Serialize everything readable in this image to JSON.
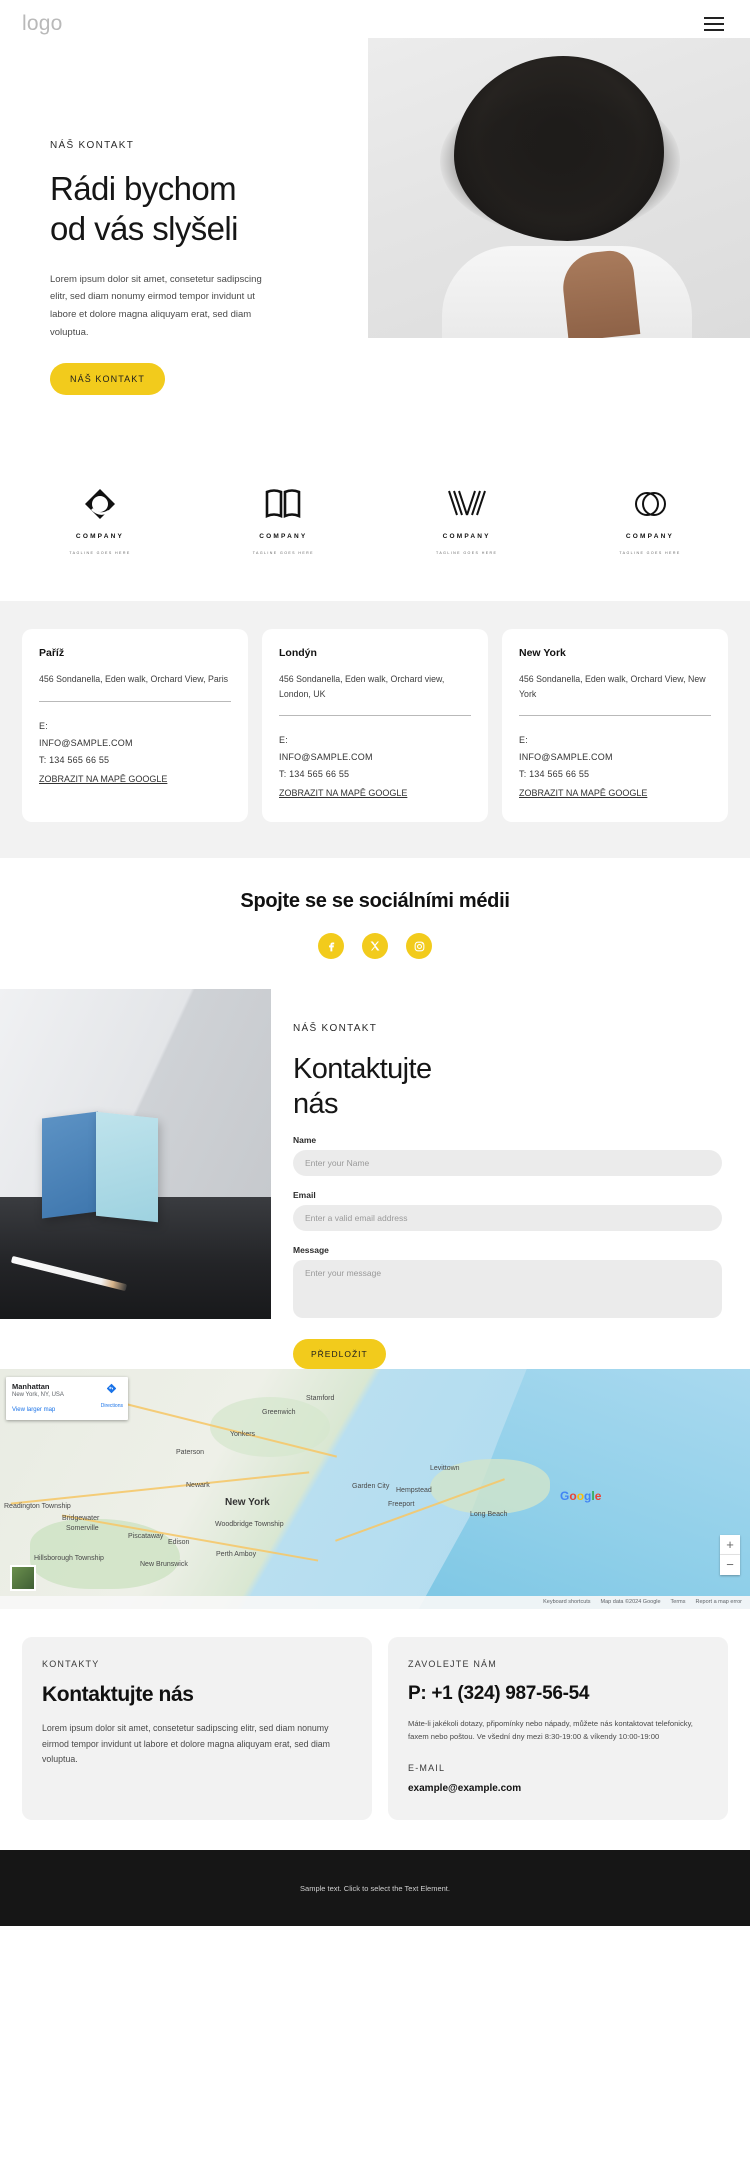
{
  "header": {
    "logo": "logo",
    "menu_icon": "hamburger-menu-icon"
  },
  "hero": {
    "eyebrow": "NÁŠ KONTAKT",
    "title_line1": "Rádi bychom",
    "title_line2": "od vás slyšeli",
    "paragraph": "Lorem ipsum dolor sit amet, consetetur sadipscing elitr, sed diam nonumy eirmod tempor invidunt ut labore et dolore magna aliquyam erat, sed diam voluptua.",
    "cta": "NÁŠ KONTAKT"
  },
  "logos": [
    {
      "name": "COMPANY",
      "tagline": "TAGLINE GOES HERE",
      "mark": "ring-logo-icon"
    },
    {
      "name": "COMPANY",
      "tagline": "TAGLINE GOES HERE",
      "mark": "book-logo-icon"
    },
    {
      "name": "COMPANY",
      "tagline": "TAGLINE GOES HERE",
      "mark": "chevron-logo-icon"
    },
    {
      "name": "COMPANY",
      "tagline": "TAGLINE GOES HERE",
      "mark": "circles-logo-icon"
    }
  ],
  "locations": [
    {
      "city": "Paříž",
      "address": "456 Sondanella, Eden walk, Orchard View, Paris",
      "email_label": "E:",
      "email": "INFO@SAMPLE.COM",
      "phone": "T: 134 565 66 55",
      "map_link": "ZOBRAZIT NA MAPĚ GOOGLE"
    },
    {
      "city": "Londýn",
      "address": "456 Sondanella, Eden walk, Orchard view, London, UK",
      "email_label": "E:",
      "email": "INFO@SAMPLE.COM",
      "phone": "T: 134 565 66 55",
      "map_link": "ZOBRAZIT NA MAPĚ GOOGLE"
    },
    {
      "city": "New York",
      "address": "456 Sondanella, Eden walk, Orchard View, New York",
      "email_label": "E:",
      "email": "INFO@SAMPLE.COM",
      "phone": "T: 134 565 66 55",
      "map_link": "ZOBRAZIT NA MAPĚ GOOGLE"
    }
  ],
  "social": {
    "heading": "Spojte se se sociálními médii",
    "items": [
      {
        "name": "facebook-icon"
      },
      {
        "name": "x-twitter-icon"
      },
      {
        "name": "instagram-icon"
      }
    ]
  },
  "contact_form": {
    "eyebrow": "NÁŠ KONTAKT",
    "title_line1": "Kontaktujte",
    "title_line2": "nás",
    "name_label": "Name",
    "name_placeholder": "Enter your Name",
    "email_label": "Email",
    "email_placeholder": "Enter a valid email address",
    "message_label": "Message",
    "message_placeholder": "Enter your message",
    "submit": "PŘEDLOŽIT"
  },
  "map": {
    "card_title": "Manhattan",
    "card_sub": "New York, NY, USA",
    "card_link": "View larger map",
    "directions": "Directions",
    "zoom_in": "+",
    "zoom_out": "−",
    "footer_shortcuts": "Keyboard shortcuts",
    "footer_data": "Map data ©2024 Google",
    "footer_terms": "Terms",
    "footer_report": "Report a map error",
    "labels": {
      "new_york": "New York",
      "newark": "Newark",
      "yonkers": "Yonkers",
      "edison": "Edison",
      "perth_amboy": "Perth Amboy",
      "woodbridge": "Woodbridge Township",
      "piscataway": "Piscataway",
      "long_beach": "Long Beach",
      "hempstead": "Hempstead",
      "bridgewater": "Bridgewater",
      "somerville": "Somerville",
      "new_brunswick": "New Brunswick",
      "paterson": "Paterson",
      "stamford": "Stamford",
      "greenwich": "Greenwich",
      "levittown": "Levittown",
      "freeport": "Freeport",
      "garden_city": "Garden City",
      "hillsborough": "Hillsborough Township",
      "readington": "Readington Township"
    }
  },
  "bottom": {
    "left": {
      "eyebrow": "KONTAKTY",
      "title": "Kontaktujte nás",
      "paragraph": "Lorem ipsum dolor sit amet, consetetur sadipscing elitr, sed diam nonumy eirmod tempor invidunt ut labore et dolore magna aliquyam erat, sed diam voluptua."
    },
    "right": {
      "eyebrow": "ZAVOLEJTE NÁM",
      "phone": "P: +1 (324) 987-56-54",
      "note": "Máte-li jakékoli dotazy, připomínky nebo nápady, můžete nás kontaktovat telefonicky, faxem nebo poštou. Ve všední dny mezi 8:30-19:00 & víkendy 10:00-19:00",
      "email_label": "E-MAIL",
      "email": "example@example.com"
    }
  },
  "footer": {
    "text": "Sample text. Click to select the Text Element."
  },
  "colors": {
    "accent": "#f2cb1c",
    "dark": "#161616",
    "light_gray": "#f2f2f2"
  }
}
